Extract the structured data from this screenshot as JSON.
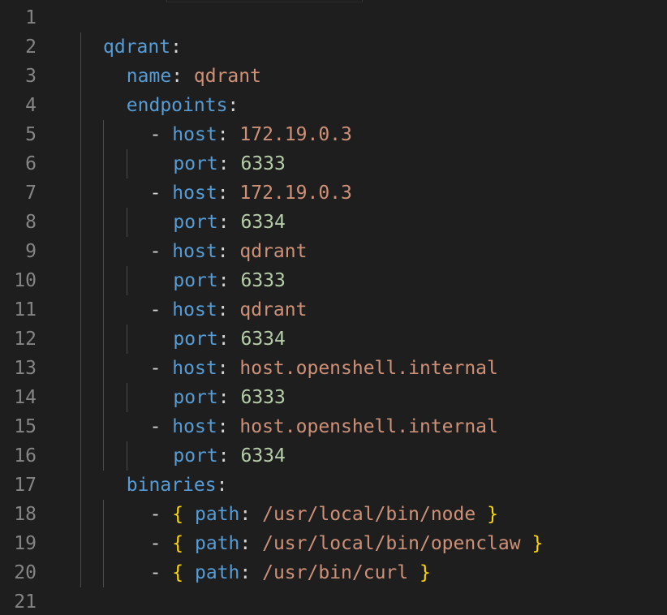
{
  "editor": {
    "lines": [
      {
        "n": "1",
        "indent": 0,
        "tokens": []
      },
      {
        "n": "2",
        "indent": 0,
        "tokens": [
          {
            "t": "qdrant",
            "c": "key"
          },
          {
            "t": ":",
            "c": "pun"
          }
        ]
      },
      {
        "n": "3",
        "indent": 1,
        "tokens": [
          {
            "t": "name",
            "c": "key"
          },
          {
            "t": ": ",
            "c": "pun"
          },
          {
            "t": "qdrant",
            "c": "str"
          }
        ]
      },
      {
        "n": "4",
        "indent": 1,
        "tokens": [
          {
            "t": "endpoints",
            "c": "key"
          },
          {
            "t": ":",
            "c": "pun"
          }
        ]
      },
      {
        "n": "5",
        "indent": 2,
        "tokens": [
          {
            "t": "- ",
            "c": "pun"
          },
          {
            "t": "host",
            "c": "key"
          },
          {
            "t": ": ",
            "c": "pun"
          },
          {
            "t": "172.19.0.3",
            "c": "str"
          }
        ]
      },
      {
        "n": "6",
        "indent": 3,
        "tokens": [
          {
            "t": "port",
            "c": "key"
          },
          {
            "t": ": ",
            "c": "pun"
          },
          {
            "t": "6333",
            "c": "num"
          }
        ]
      },
      {
        "n": "7",
        "indent": 2,
        "tokens": [
          {
            "t": "- ",
            "c": "pun"
          },
          {
            "t": "host",
            "c": "key"
          },
          {
            "t": ": ",
            "c": "pun"
          },
          {
            "t": "172.19.0.3",
            "c": "str"
          }
        ]
      },
      {
        "n": "8",
        "indent": 3,
        "tokens": [
          {
            "t": "port",
            "c": "key"
          },
          {
            "t": ": ",
            "c": "pun"
          },
          {
            "t": "6334",
            "c": "num"
          }
        ]
      },
      {
        "n": "9",
        "indent": 2,
        "tokens": [
          {
            "t": "- ",
            "c": "pun"
          },
          {
            "t": "host",
            "c": "key"
          },
          {
            "t": ": ",
            "c": "pun"
          },
          {
            "t": "qdrant",
            "c": "str"
          }
        ]
      },
      {
        "n": "10",
        "indent": 3,
        "tokens": [
          {
            "t": "port",
            "c": "key"
          },
          {
            "t": ": ",
            "c": "pun"
          },
          {
            "t": "6333",
            "c": "num"
          }
        ]
      },
      {
        "n": "11",
        "indent": 2,
        "tokens": [
          {
            "t": "- ",
            "c": "pun"
          },
          {
            "t": "host",
            "c": "key"
          },
          {
            "t": ": ",
            "c": "pun"
          },
          {
            "t": "qdrant",
            "c": "str"
          }
        ]
      },
      {
        "n": "12",
        "indent": 3,
        "tokens": [
          {
            "t": "port",
            "c": "key"
          },
          {
            "t": ": ",
            "c": "pun"
          },
          {
            "t": "6334",
            "c": "num"
          }
        ]
      },
      {
        "n": "13",
        "indent": 2,
        "tokens": [
          {
            "t": "- ",
            "c": "pun"
          },
          {
            "t": "host",
            "c": "key"
          },
          {
            "t": ": ",
            "c": "pun"
          },
          {
            "t": "host.openshell.internal",
            "c": "str"
          }
        ]
      },
      {
        "n": "14",
        "indent": 3,
        "tokens": [
          {
            "t": "port",
            "c": "key"
          },
          {
            "t": ": ",
            "c": "pun"
          },
          {
            "t": "6333",
            "c": "num"
          }
        ]
      },
      {
        "n": "15",
        "indent": 2,
        "tokens": [
          {
            "t": "- ",
            "c": "pun"
          },
          {
            "t": "host",
            "c": "key"
          },
          {
            "t": ": ",
            "c": "pun"
          },
          {
            "t": "host.openshell.internal",
            "c": "str"
          }
        ]
      },
      {
        "n": "16",
        "indent": 3,
        "tokens": [
          {
            "t": "port",
            "c": "key"
          },
          {
            "t": ": ",
            "c": "pun"
          },
          {
            "t": "6334",
            "c": "num"
          }
        ]
      },
      {
        "n": "17",
        "indent": 1,
        "tokens": [
          {
            "t": "binaries",
            "c": "key"
          },
          {
            "t": ":",
            "c": "pun"
          }
        ]
      },
      {
        "n": "18",
        "indent": 2,
        "tokens": [
          {
            "t": "- ",
            "c": "pun"
          },
          {
            "t": "{",
            "c": "brace"
          },
          {
            "t": " ",
            "c": "pun"
          },
          {
            "t": "path",
            "c": "key"
          },
          {
            "t": ": ",
            "c": "pun"
          },
          {
            "t": "/usr/local/bin/node",
            "c": "str"
          },
          {
            "t": " ",
            "c": "pun"
          },
          {
            "t": "}",
            "c": "brace"
          }
        ]
      },
      {
        "n": "19",
        "indent": 2,
        "tokens": [
          {
            "t": "- ",
            "c": "pun"
          },
          {
            "t": "{",
            "c": "brace"
          },
          {
            "t": " ",
            "c": "pun"
          },
          {
            "t": "path",
            "c": "key"
          },
          {
            "t": ": ",
            "c": "pun"
          },
          {
            "t": "/usr/local/bin/openclaw",
            "c": "str"
          },
          {
            "t": " ",
            "c": "pun"
          },
          {
            "t": "}",
            "c": "brace"
          }
        ]
      },
      {
        "n": "20",
        "indent": 2,
        "tokens": [
          {
            "t": "- ",
            "c": "pun"
          },
          {
            "t": "{",
            "c": "brace"
          },
          {
            "t": " ",
            "c": "pun"
          },
          {
            "t": "path",
            "c": "key"
          },
          {
            "t": ": ",
            "c": "pun"
          },
          {
            "t": "/usr/bin/curl",
            "c": "str"
          },
          {
            "t": " ",
            "c": "pun"
          },
          {
            "t": "}",
            "c": "brace"
          }
        ]
      },
      {
        "n": "21",
        "indent": 0,
        "tokens": []
      }
    ]
  },
  "colors": {
    "background": "#1e1e1e",
    "line_number": "#858585",
    "key": "#569cd6",
    "string": "#ce9178",
    "number": "#b5cea8",
    "brace": "#ffd700",
    "punctuation": "#d4d4d4"
  }
}
